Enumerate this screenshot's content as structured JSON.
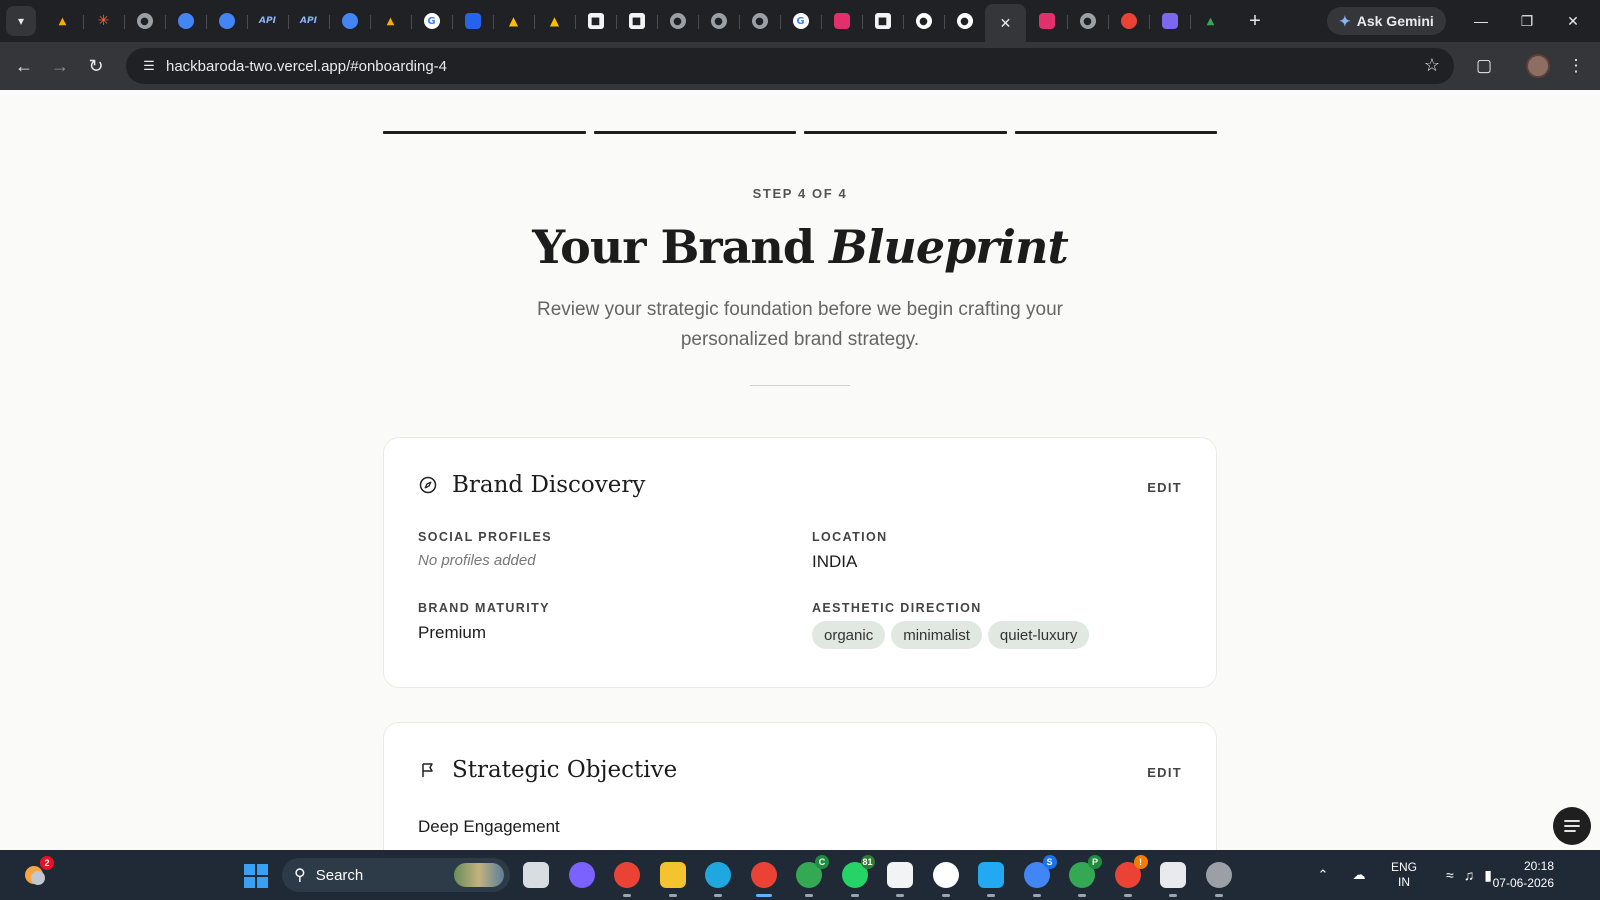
{
  "browser": {
    "tabs": [
      {
        "icon": "drive-triangle-icon"
      },
      {
        "icon": "claude-star-icon"
      },
      {
        "icon": "globe-icon"
      },
      {
        "icon": "google-cloud-icon"
      },
      {
        "icon": "google-cloud-icon"
      },
      {
        "icon": "api-icon",
        "text": "API"
      },
      {
        "icon": "api-icon",
        "text": "API"
      },
      {
        "icon": "google-cloud-icon"
      },
      {
        "icon": "drive-triangle-icon"
      },
      {
        "icon": "google-icon"
      },
      {
        "icon": "swift-icon"
      },
      {
        "icon": "firebase-icon"
      },
      {
        "icon": "firebase-icon"
      },
      {
        "icon": "cube-icon"
      },
      {
        "icon": "cube-icon"
      },
      {
        "icon": "globe-icon"
      },
      {
        "icon": "globe-icon"
      },
      {
        "icon": "globe-icon"
      },
      {
        "icon": "google-icon"
      },
      {
        "icon": "instagram-icon"
      },
      {
        "icon": "cube-icon"
      },
      {
        "icon": "github-icon"
      },
      {
        "icon": "github-icon"
      },
      {
        "icon": "close-icon",
        "active": true
      },
      {
        "icon": "instagram-icon"
      },
      {
        "icon": "globe-icon"
      },
      {
        "icon": "rocket-icon"
      },
      {
        "icon": "grid-icon"
      },
      {
        "icon": "drive-icon"
      }
    ],
    "new_tab": "+",
    "ask_gemini": "Ask Gemini",
    "url": "hackbaroda-two.vercel.app/#onboarding-4"
  },
  "page": {
    "progress_steps": 4,
    "progress_completed": 4,
    "step_label": "STEP 4 OF 4",
    "title_plain": "Your Brand ",
    "title_italic": "Blueprint",
    "subtitle": "Review your strategic foundation before we begin crafting your personalized brand strategy.",
    "cards": {
      "discovery": {
        "icon": "compass-icon",
        "title": "Brand Discovery",
        "edit": "EDIT",
        "social_label": "SOCIAL PROFILES",
        "social_value": "No profiles added",
        "location_label": "LOCATION",
        "location_value": "INDIA",
        "maturity_label": "BRAND MATURITY",
        "maturity_value": "Premium",
        "aesthetic_label": "AESTHETIC DIRECTION",
        "aesthetic_tags": [
          "organic",
          "minimalist",
          "quiet-luxury"
        ]
      },
      "objective": {
        "icon": "flag-icon",
        "title": "Strategic Objective",
        "edit": "EDIT",
        "value": "Deep Engagement"
      }
    }
  },
  "taskbar": {
    "weather_badge": "2",
    "search": "Search",
    "apps": [
      {
        "name": "task-view-icon",
        "color": "#d8dde2"
      },
      {
        "name": "copilot-icon",
        "color": "#7b61ff"
      },
      {
        "name": "chrome-icon",
        "color": "#ea4335"
      },
      {
        "name": "file-explorer-icon",
        "color": "#f4c430"
      },
      {
        "name": "edge-icon",
        "color": "#1fa7e0"
      },
      {
        "name": "chrome-profile-icon",
        "color": "#ea4335",
        "active": true
      },
      {
        "name": "chrome-profile-c-icon",
        "color": "#34a853",
        "badge": "C"
      },
      {
        "name": "whatsapp-icon",
        "color": "#25d366",
        "badge": "81"
      },
      {
        "name": "cube-app-icon",
        "color": "#f1f3f4"
      },
      {
        "name": "arc-icon",
        "color": "#ffffff"
      },
      {
        "name": "vscode-icon",
        "color": "#23a8f2"
      },
      {
        "name": "chrome-profile-s-icon",
        "color": "#4285f4",
        "badge": "S"
      },
      {
        "name": "chrome-profile-p-icon",
        "color": "#34a853",
        "badge": "P"
      },
      {
        "name": "chrome-profile-alert-icon",
        "color": "#ea4335",
        "badge": "!"
      },
      {
        "name": "snipping-tool-icon",
        "color": "#e8eaed"
      },
      {
        "name": "media-player-icon",
        "color": "#9aa0a6"
      }
    ],
    "lang_top": "ENG",
    "lang_bottom": "IN",
    "time": "20:18",
    "date": "07-06-2026"
  }
}
